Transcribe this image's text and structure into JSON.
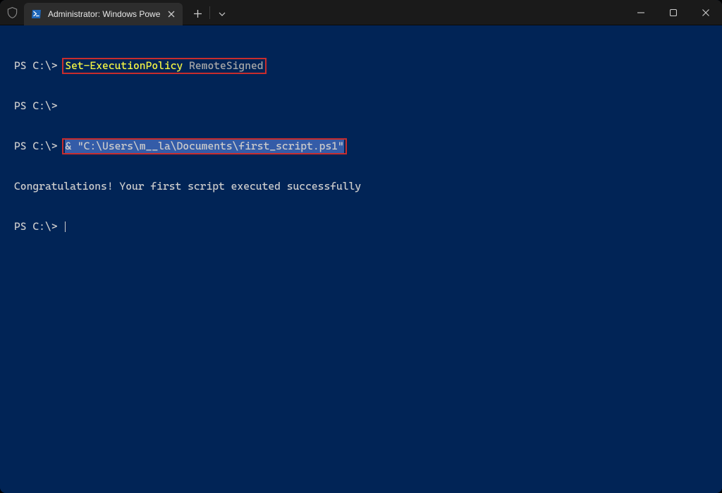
{
  "tab": {
    "title": "Administrator: Windows Powe"
  },
  "terminal": {
    "prompt": "PS C:\\> ",
    "line1_cmd_part1": "Set-ExecutionPolicy",
    "line1_cmd_part2": " RemoteSigned",
    "line3_cmd_part1": "& ",
    "line3_cmd_part2": "\"C:\\Users\\m__la\\Documents\\first_script.ps1\"",
    "output1": "Congratulations! Your first script executed successfully"
  }
}
